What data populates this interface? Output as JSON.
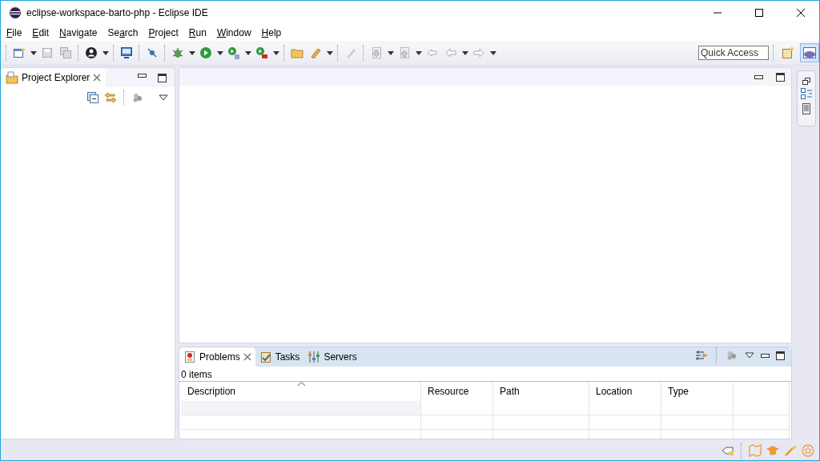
{
  "window": {
    "title": "eclipse-workspace-barto-php - Eclipse IDE"
  },
  "menu": [
    {
      "key": "F",
      "post": "ile"
    },
    {
      "key": "E",
      "post": "dit"
    },
    {
      "key": "N",
      "post": "avigate"
    },
    {
      "pre": "Se",
      "key": "a",
      "post": "rch"
    },
    {
      "key": "P",
      "post": "roject"
    },
    {
      "key": "R",
      "post": "un"
    },
    {
      "key": "W",
      "post": "indow"
    },
    {
      "key": "H",
      "post": "elp"
    }
  ],
  "toolbar": {
    "quick_access": {
      "placeholder": "Quick Access"
    }
  },
  "explorer": {
    "tabs": [
      {
        "label": "Project Explorer",
        "selected": true
      }
    ]
  },
  "bottom_panel": {
    "tabs": [
      {
        "label": "Problems",
        "selected": true
      },
      {
        "label": "Tasks",
        "selected": false
      },
      {
        "label": "Servers",
        "selected": false
      }
    ],
    "summary": "0 items",
    "table": {
      "columns": [
        "Description",
        "Resource",
        "Path",
        "Location",
        "Type"
      ]
    }
  }
}
